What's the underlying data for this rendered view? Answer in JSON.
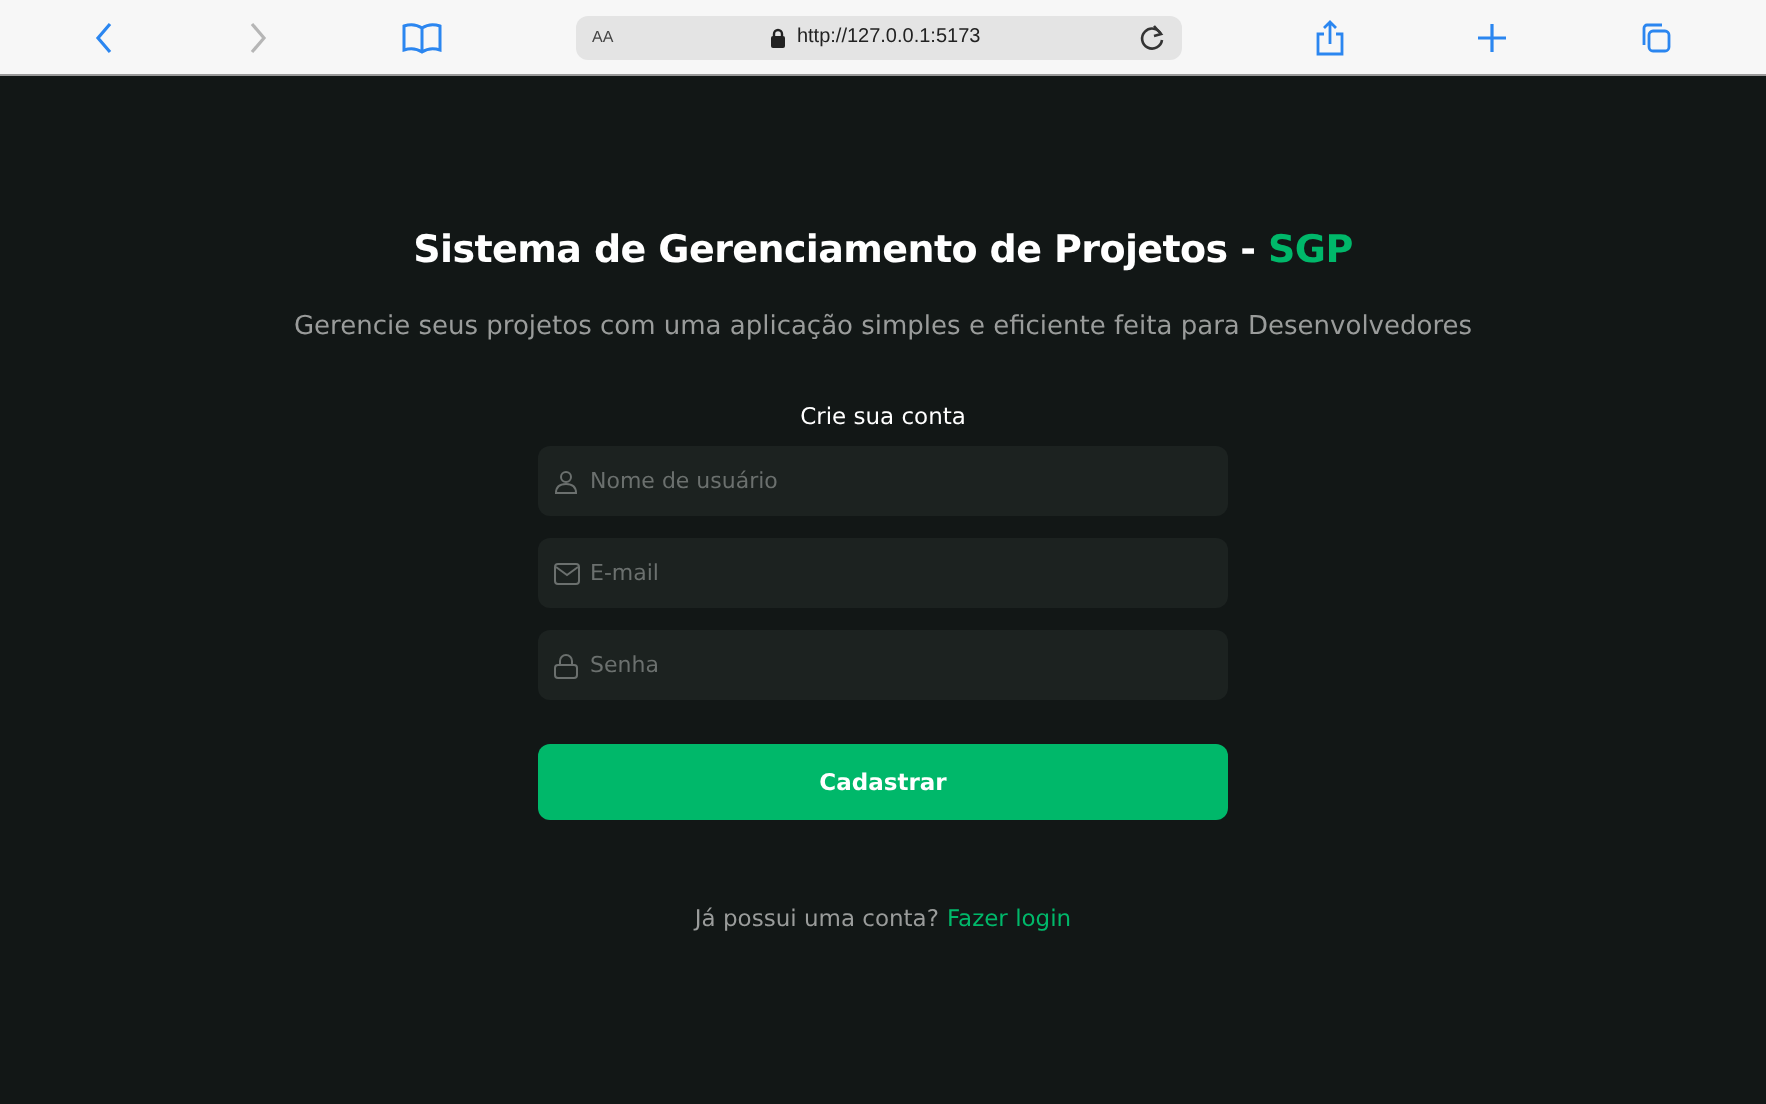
{
  "browser": {
    "text_size": "AA",
    "url": "http://127.0.0.1:5173",
    "back_disabled": false,
    "forward_disabled": true
  },
  "header": {
    "title": "Sistema de Gerenciamento de Projetos - ",
    "title_highlight": "SGP",
    "subtitle": "Gerencie seus projetos com uma aplicação simples e eficiente feita para Desenvolvedores"
  },
  "form": {
    "heading": "Crie sua conta",
    "fields": [
      {
        "kind": "user",
        "placeholder": "Nome de usuário"
      },
      {
        "kind": "email",
        "placeholder": "E-mail"
      },
      {
        "kind": "password",
        "placeholder": "Senha"
      }
    ],
    "submit": "Cadastrar"
  },
  "footer": {
    "prompt": "Já possui uma conta?",
    "link": "Fazer login"
  }
}
